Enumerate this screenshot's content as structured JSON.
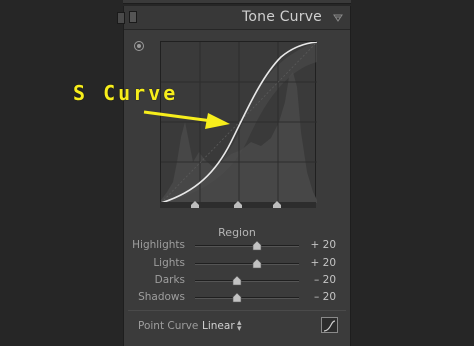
{
  "panel": {
    "title": "Tone Curve",
    "menu_icon": "triangle-menu-icon",
    "toggle_icon": "panel-switch-icon"
  },
  "curve": {
    "target_icon": "targeted-adjustment-icon",
    "split_points": [
      0.25,
      0.5,
      0.75
    ]
  },
  "region": {
    "title": "Region",
    "sliders": [
      {
        "label": "Highlights",
        "value": "+ 20",
        "level": 0.6
      },
      {
        "label": "Lights",
        "value": "+ 20",
        "level": 0.6
      },
      {
        "label": "Darks",
        "value": "– 20",
        "level": 0.4
      },
      {
        "label": "Shadows",
        "value": "– 20",
        "level": 0.4
      }
    ]
  },
  "point_curve": {
    "label": "Point Curve :",
    "value": "Linear",
    "chevron": "▴▾",
    "edit_icon": "edit-point-curve-icon"
  },
  "annotation": {
    "text": "S Curve",
    "color": "#f7ee1c"
  }
}
